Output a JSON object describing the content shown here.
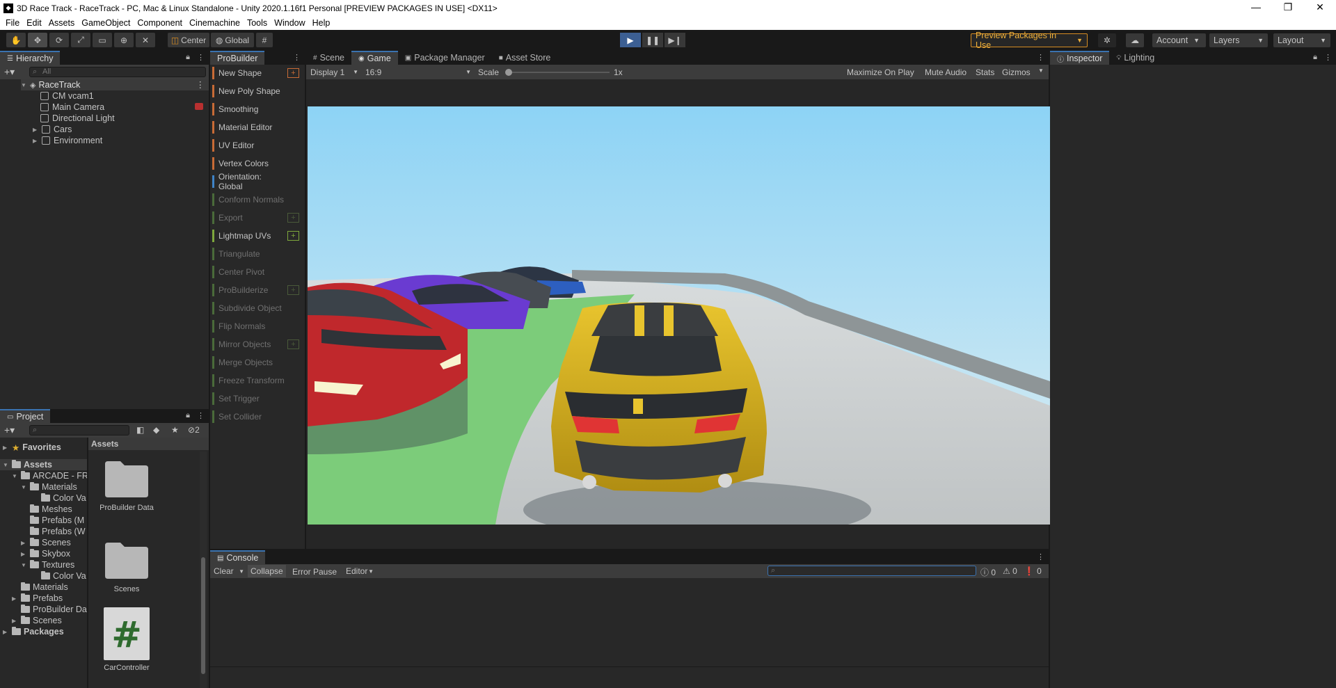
{
  "window": {
    "title": "3D Race Track - RaceTrack - PC, Mac & Linux Standalone - Unity 2020.1.16f1 Personal [PREVIEW PACKAGES IN USE] <DX11>",
    "minimize": "—",
    "maximize": "❐",
    "close": "✕"
  },
  "menu": [
    "File",
    "Edit",
    "Assets",
    "GameObject",
    "Component",
    "Cinemachine",
    "Tools",
    "Window",
    "Help"
  ],
  "toolbar": {
    "pivot_label": "Center",
    "space_label": "Global",
    "preview_packages": "Preview Packages in Use",
    "account": "Account",
    "layers": "Layers",
    "layout": "Layout"
  },
  "hierarchy": {
    "tab": "Hierarchy",
    "search_placeholder": "All",
    "scene": "RaceTrack",
    "items": [
      {
        "label": "CM vcam1"
      },
      {
        "label": "Main Camera"
      },
      {
        "label": "Directional Light"
      },
      {
        "label": "Cars"
      },
      {
        "label": "Environment"
      }
    ]
  },
  "probuilder": {
    "tab": "ProBuilder",
    "items": [
      {
        "label": "New Shape",
        "color": "#c86b36",
        "plus": true,
        "enabled": true
      },
      {
        "label": "New Poly Shape",
        "color": "#c86b36",
        "plus": false,
        "enabled": true
      },
      {
        "label": "Smoothing",
        "color": "#c86b36",
        "plus": false,
        "enabled": true
      },
      {
        "label": "Material Editor",
        "color": "#c86b36",
        "plus": false,
        "enabled": true
      },
      {
        "label": "UV Editor",
        "color": "#c86b36",
        "plus": false,
        "enabled": true
      },
      {
        "label": "Vertex Colors",
        "color": "#c86b36",
        "plus": false,
        "enabled": true
      },
      {
        "label": "Orientation: Global",
        "color": "#3f84c8",
        "plus": false,
        "enabled": true
      },
      {
        "label": "Conform Normals",
        "color": "#4a6b3a",
        "plus": false,
        "enabled": false
      },
      {
        "label": "Export",
        "color": "#4a6b3a",
        "plus": true,
        "enabled": false
      },
      {
        "label": "Lightmap UVs",
        "color": "#7ea83c",
        "plus": true,
        "enabled": true
      },
      {
        "label": "Triangulate",
        "color": "#4a6b3a",
        "plus": false,
        "enabled": false
      },
      {
        "label": "Center Pivot",
        "color": "#4a6b3a",
        "plus": false,
        "enabled": false
      },
      {
        "label": "ProBuilderize",
        "color": "#4a6b3a",
        "plus": true,
        "enabled": false
      },
      {
        "label": "Subdivide Object",
        "color": "#4a6b3a",
        "plus": false,
        "enabled": false
      },
      {
        "label": "Flip Normals",
        "color": "#4a6b3a",
        "plus": false,
        "enabled": false
      },
      {
        "label": "Mirror Objects",
        "color": "#4a6b3a",
        "plus": true,
        "enabled": false
      },
      {
        "label": "Merge Objects",
        "color": "#4a6b3a",
        "plus": false,
        "enabled": false
      },
      {
        "label": "Freeze Transform",
        "color": "#4a6b3a",
        "plus": false,
        "enabled": false
      },
      {
        "label": "Set Trigger",
        "color": "#4a6b3a",
        "plus": false,
        "enabled": false
      },
      {
        "label": "Set Collider",
        "color": "#4a6b3a",
        "plus": false,
        "enabled": false
      }
    ]
  },
  "center_tabs": [
    "Scene",
    "Game",
    "Package Manager",
    "Asset Store"
  ],
  "game": {
    "display": "Display 1",
    "aspect": "16:9",
    "scale_label": "Scale",
    "scale_value": "1x",
    "maximize": "Maximize On Play",
    "mute": "Mute Audio",
    "stats": "Stats",
    "gizmos": "Gizmos"
  },
  "inspector": {
    "tab": "Inspector",
    "lighting_tab": "Lighting"
  },
  "console": {
    "tab": "Console",
    "clear": "Clear",
    "collapse": "Collapse",
    "error_pause": "Error Pause",
    "editor": "Editor",
    "log_count": "0",
    "warn_count": "0",
    "error_count": "0"
  },
  "project": {
    "tab": "Project",
    "hidden_count": "2",
    "favorites": "Favorites",
    "assets_root": "Assets",
    "breadcrumb": "Assets",
    "tree": [
      {
        "label": "ARCADE - FR"
      },
      {
        "label": "Materials"
      },
      {
        "label": "Color Va"
      },
      {
        "label": "Meshes"
      },
      {
        "label": "Prefabs (M"
      },
      {
        "label": "Prefabs (W"
      },
      {
        "label": "Scenes"
      },
      {
        "label": "Skybox"
      },
      {
        "label": "Textures"
      },
      {
        "label": "Color Va"
      },
      {
        "label": "Materials"
      },
      {
        "label": "Prefabs"
      },
      {
        "label": "ProBuilder Da"
      },
      {
        "label": "Scenes"
      },
      {
        "label": "Packages"
      }
    ],
    "grid": [
      {
        "label": "ProBuilder Data"
      },
      {
        "label": "Scenes"
      },
      {
        "label": "CarController"
      }
    ],
    "script_glyph": "#"
  }
}
